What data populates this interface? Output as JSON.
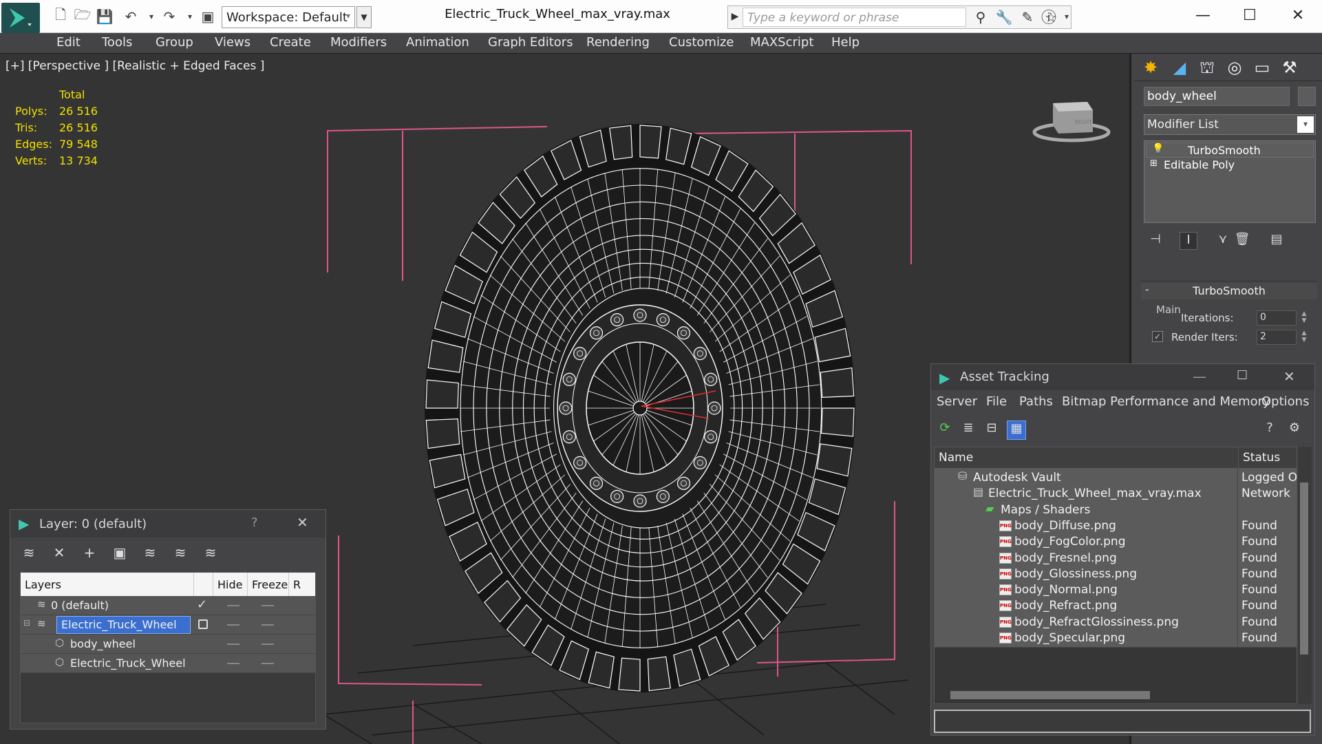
{
  "titlebar": {
    "workspace": "Workspace: Default",
    "window_title": "Electric_Truck_Wheel_max_vray.max",
    "search_placeholder": "Type a keyword or phrase"
  },
  "menu": [
    "Edit",
    "Tools",
    "Group",
    "Views",
    "Create",
    "Modifiers",
    "Animation",
    "Graph Editors",
    "Rendering",
    "Customize",
    "MAXScript",
    "Help"
  ],
  "viewport": {
    "label": "[+] [Perspective ] [Realistic + Edged Faces ]",
    "stats": {
      "header": "Total",
      "rows": [
        {
          "k": "Polys:",
          "v": "26 516"
        },
        {
          "k": "Tris:",
          "v": "26 516"
        },
        {
          "k": "Edges:",
          "v": "79 548"
        },
        {
          "k": "Verts:",
          "v": "13 734"
        }
      ]
    },
    "viewcube_label": "RIGHT"
  },
  "command_panel": {
    "object_name": "body_wheel",
    "modifier_list": "Modifier List",
    "stack": [
      "TurboSmooth",
      "Editable Poly"
    ],
    "rollout_title": "TurboSmooth",
    "main_label": "Main",
    "iterations_label": "Iterations:",
    "iterations_value": "0",
    "render_iters_label": "Render Iters:",
    "render_iters_value": "2"
  },
  "asset_tracking": {
    "title": "Asset Tracking",
    "menu": [
      "Server",
      "File",
      "Paths",
      "Bitmap Performance and Memory",
      "Options"
    ],
    "columns": {
      "name": "Name",
      "status": "Status"
    },
    "rows": [
      {
        "name": "Autodesk Vault",
        "status": "Logged O",
        "indent": 1
      },
      {
        "name": "Electric_Truck_Wheel_max_vray.max",
        "status": "Network",
        "indent": 2
      },
      {
        "name": "Maps / Shaders",
        "status": "",
        "indent": 3
      },
      {
        "name": "body_Diffuse.png",
        "status": "Found",
        "indent": 4
      },
      {
        "name": "body_FogColor.png",
        "status": "Found",
        "indent": 4
      },
      {
        "name": "body_Fresnel.png",
        "status": "Found",
        "indent": 4
      },
      {
        "name": "body_Glossiness.png",
        "status": "Found",
        "indent": 4
      },
      {
        "name": "body_Normal.png",
        "status": "Found",
        "indent": 4
      },
      {
        "name": "body_Refract.png",
        "status": "Found",
        "indent": 4
      },
      {
        "name": "body_RefractGlossiness.png",
        "status": "Found",
        "indent": 4
      },
      {
        "name": "body_Specular.png",
        "status": "Found",
        "indent": 4
      }
    ]
  },
  "layer_dialog": {
    "title": "Layer: 0 (default)",
    "help": "?",
    "columns": {
      "layers": "Layers",
      "hide": "Hide",
      "freeze": "Freeze",
      "r": "R"
    },
    "rows": [
      {
        "name": "0 (default)"
      },
      {
        "name": "Electric_Truck_Wheel"
      },
      {
        "name": "body_wheel"
      },
      {
        "name": "Electric_Truck_Wheel"
      }
    ]
  },
  "colors": {
    "accent": "#3a6fd0",
    "stats_text": "#f0e000",
    "bbox": "#e0558c",
    "wire": "#ffffff"
  }
}
